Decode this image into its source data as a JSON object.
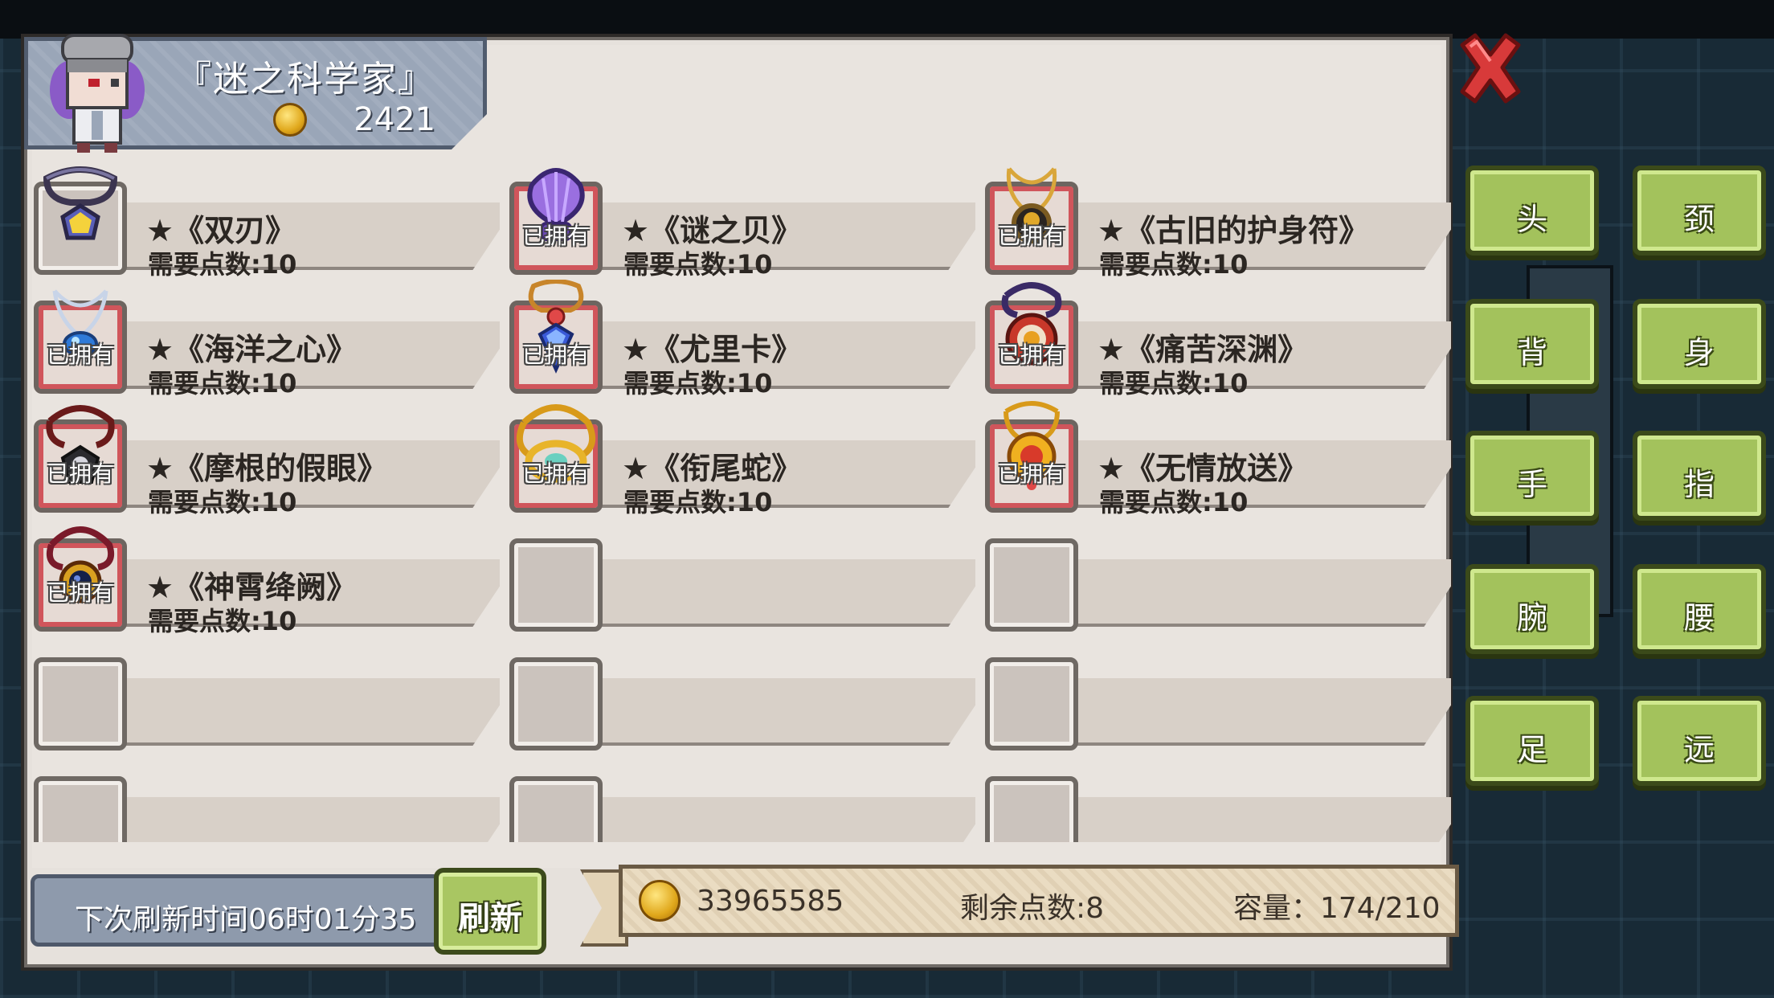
{
  "npc": {
    "name": "『迷之科学家』",
    "coins": "2421"
  },
  "owned_label": "已拥有",
  "items": [
    {
      "name": "★《双刃》",
      "cost": "需要点数:10",
      "owned": false,
      "icon": "amulet-yellow-gem-icon"
    },
    {
      "name": "★《谜之贝》",
      "cost": "需要点数:10",
      "owned": true,
      "icon": "purple-shell-necklace-icon"
    },
    {
      "name": "★《古旧的护身符》",
      "cost": "需要点数:10",
      "owned": true,
      "icon": "old-amulet-icon"
    },
    {
      "name": "★《海洋之心》",
      "cost": "需要点数:10",
      "owned": true,
      "icon": "ocean-heart-necklace-icon"
    },
    {
      "name": "★《尤里卡》",
      "cost": "需要点数:10",
      "owned": true,
      "icon": "eureka-pendant-icon"
    },
    {
      "name": "★《痛苦深渊》",
      "cost": "需要点数:10",
      "owned": true,
      "icon": "abyss-pendant-icon"
    },
    {
      "name": "★《摩根的假眼》",
      "cost": "需要点数:10",
      "owned": true,
      "icon": "fake-eye-pendant-icon"
    },
    {
      "name": "★《衔尾蛇》",
      "cost": "需要点数:10",
      "owned": true,
      "icon": "ouroboros-necklace-icon"
    },
    {
      "name": "★《无情放送》",
      "cost": "需要点数:10",
      "owned": true,
      "icon": "sun-pendant-icon"
    },
    {
      "name": "★《神霄绛阙》",
      "cost": "需要点数:10",
      "owned": true,
      "icon": "dark-orb-necklace-icon"
    }
  ],
  "refresh": {
    "timer_text": "下次刷新时间06时01分35",
    "button_label": "刷新"
  },
  "stats": {
    "gold": "33965585",
    "points": "剩余点数:8",
    "capacity": "容量：174/210"
  },
  "categories": [
    "头",
    "颈",
    "背",
    "身",
    "手",
    "指",
    "腕",
    "腰",
    "足",
    "远"
  ],
  "colors": {
    "panel": "#e9e4df",
    "category_button": "#a3c25c",
    "owned_frame": "#d0555b",
    "close": "#d83a3a"
  }
}
